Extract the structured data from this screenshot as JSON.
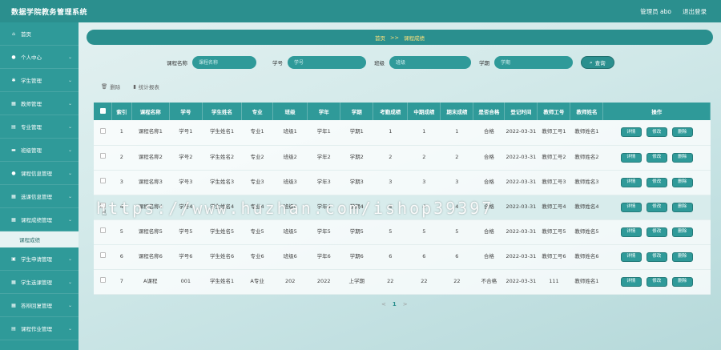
{
  "app": {
    "title": "数据学院教务管理系统"
  },
  "topbar": {
    "user": "管理员 abo",
    "logout": "退出登录"
  },
  "sidebar": {
    "items": [
      {
        "label": "首页",
        "icon": "home-icon",
        "glyph": "⌂",
        "chevron": false
      },
      {
        "label": "个人中心",
        "icon": "user-icon",
        "glyph": "●",
        "chevron": true
      },
      {
        "label": "学生管理",
        "icon": "student-icon",
        "glyph": "✱",
        "chevron": true
      },
      {
        "label": "教师管理",
        "icon": "grid-icon",
        "glyph": "▦",
        "chevron": true
      },
      {
        "label": "专业管理",
        "icon": "doc-icon",
        "glyph": "▤",
        "chevron": true
      },
      {
        "label": "班级管理",
        "icon": "card-icon",
        "glyph": "▬",
        "chevron": true
      },
      {
        "label": "课程信息管理",
        "icon": "person-icon",
        "glyph": "●",
        "chevron": true
      },
      {
        "label": "选课信息管理",
        "icon": "list-icon",
        "glyph": "▦",
        "chevron": true
      },
      {
        "label": "课程成绩管理",
        "icon": "list-icon",
        "glyph": "▦",
        "chevron": true,
        "active": true
      },
      {
        "label": "课程成绩",
        "sub": true
      },
      {
        "label": "学生申请管理",
        "icon": "monitor-icon",
        "glyph": "▣",
        "chevron": true
      },
      {
        "label": "学生选课管理",
        "icon": "grid-icon",
        "glyph": "▦",
        "chevron": true
      },
      {
        "label": "答辩回复管理",
        "icon": "grid-icon",
        "glyph": "▦",
        "chevron": true
      },
      {
        "label": "课程作业管理",
        "icon": "doc-icon",
        "glyph": "▤",
        "chevron": true
      }
    ]
  },
  "breadcrumb": {
    "home": "首页",
    "sep": ">>",
    "current": "课程成绩"
  },
  "search": {
    "course_label": "课程名称",
    "course_placeholder": "课程名称",
    "sid_label": "学号",
    "sid_placeholder": "学号",
    "class_label": "班级",
    "class_placeholder": "班级",
    "term_label": "学期",
    "term_placeholder": "学期",
    "button": "查询"
  },
  "actions": {
    "delete": "删除",
    "stats": "统计报表"
  },
  "table": {
    "headers": [
      "索引",
      "课程名称",
      "学号",
      "学生姓名",
      "专业",
      "班级",
      "学年",
      "学期",
      "考勤成绩",
      "中期成绩",
      "期末成绩",
      "是否合格",
      "登记时间",
      "教师工号",
      "教师姓名",
      "操作"
    ],
    "rows": [
      {
        "cells": [
          "1",
          "课程名称1",
          "学号1",
          "学生姓名1",
          "专业1",
          "班级1",
          "学年1",
          "学期1",
          "1",
          "1",
          "1",
          "合格",
          "2022-03-31",
          "教师工号1",
          "教师姓名1"
        ]
      },
      {
        "cells": [
          "2",
          "课程名称2",
          "学号2",
          "学生姓名2",
          "专业2",
          "班级2",
          "学年2",
          "学期2",
          "2",
          "2",
          "2",
          "合格",
          "2022-03-31",
          "教师工号2",
          "教师姓名2"
        ]
      },
      {
        "cells": [
          "3",
          "课程名称3",
          "学号3",
          "学生姓名3",
          "专业3",
          "班级3",
          "学年3",
          "学期3",
          "3",
          "3",
          "3",
          "合格",
          "2022-03-31",
          "教师工号3",
          "教师姓名3"
        ]
      },
      {
        "cells": [
          "4",
          "课程名称4",
          "学号4",
          "学生姓名4",
          "专业4",
          "班级4",
          "学年4",
          "学期4",
          "4",
          "4",
          "4",
          "合格",
          "2022-03-31",
          "教师工号4",
          "教师姓名4"
        ],
        "hover": true
      },
      {
        "cells": [
          "5",
          "课程名称5",
          "学号5",
          "学生姓名5",
          "专业5",
          "班级5",
          "学年5",
          "学期5",
          "5",
          "5",
          "5",
          "合格",
          "2022-03-31",
          "教师工号5",
          "教师姓名5"
        ]
      },
      {
        "cells": [
          "6",
          "课程名称6",
          "学号6",
          "学生姓名6",
          "专业6",
          "班级6",
          "学年6",
          "学期6",
          "6",
          "6",
          "6",
          "合格",
          "2022-03-31",
          "教师工号6",
          "教师姓名6"
        ]
      },
      {
        "cells": [
          "7",
          "A课程",
          "001",
          "学生姓名1",
          "A专业",
          "202",
          "2022",
          "上学期",
          "22",
          "22",
          "22",
          "不合格",
          "2022-03-31",
          "111",
          "教师姓名1"
        ]
      }
    ],
    "ops": {
      "detail": "详情",
      "edit": "修改",
      "delete": "删除"
    }
  },
  "pager": {
    "prev": "<",
    "current": "1",
    "next": ">"
  },
  "watermark": "https://www.huzhan.com/ishop39397",
  "colors": {
    "primary": "#2f9a99",
    "header": "#2b8f8e",
    "accent": "#ffe27a"
  }
}
